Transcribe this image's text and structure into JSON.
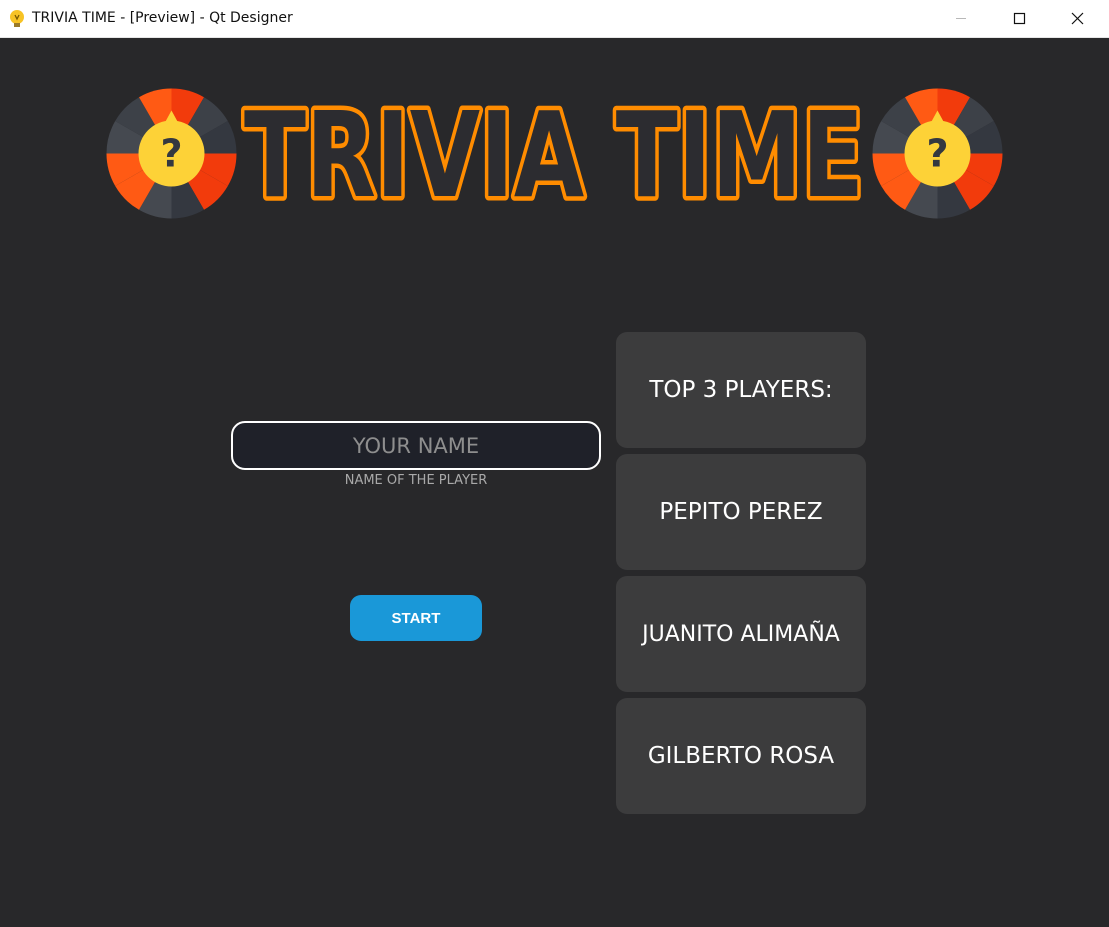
{
  "window": {
    "title": "TRIVIA TIME - [Preview] - Qt Designer",
    "icons": [
      "lightbulb-icon",
      "minimize-icon",
      "maximize-icon",
      "close-icon"
    ]
  },
  "logo": {
    "text": "TRIVIA TIME",
    "icon": "question-wheel-icon",
    "colors": {
      "text_fill": "#2c2c30",
      "text_outline": "#ff8c00",
      "wheel_orange": "#ff5a14",
      "wheel_red": "#f23b0c",
      "wheel_dark": "#3d4148",
      "center": "#fdd237"
    }
  },
  "player": {
    "name_value": "",
    "name_placeholder": "YOUR NAME",
    "name_caption": "NAME OF THE PLAYER",
    "start_label": "START"
  },
  "leaderboard": {
    "title": "TOP 3 PLAYERS:",
    "players": [
      "PEPITO PEREZ",
      "JUANITO ALIMAÑA",
      "GILBERTO ROSA"
    ]
  },
  "colors": {
    "background": "#28282a",
    "card": "#3c3c3d",
    "button": "#1a98d8",
    "input_bg": "#1f2129"
  }
}
